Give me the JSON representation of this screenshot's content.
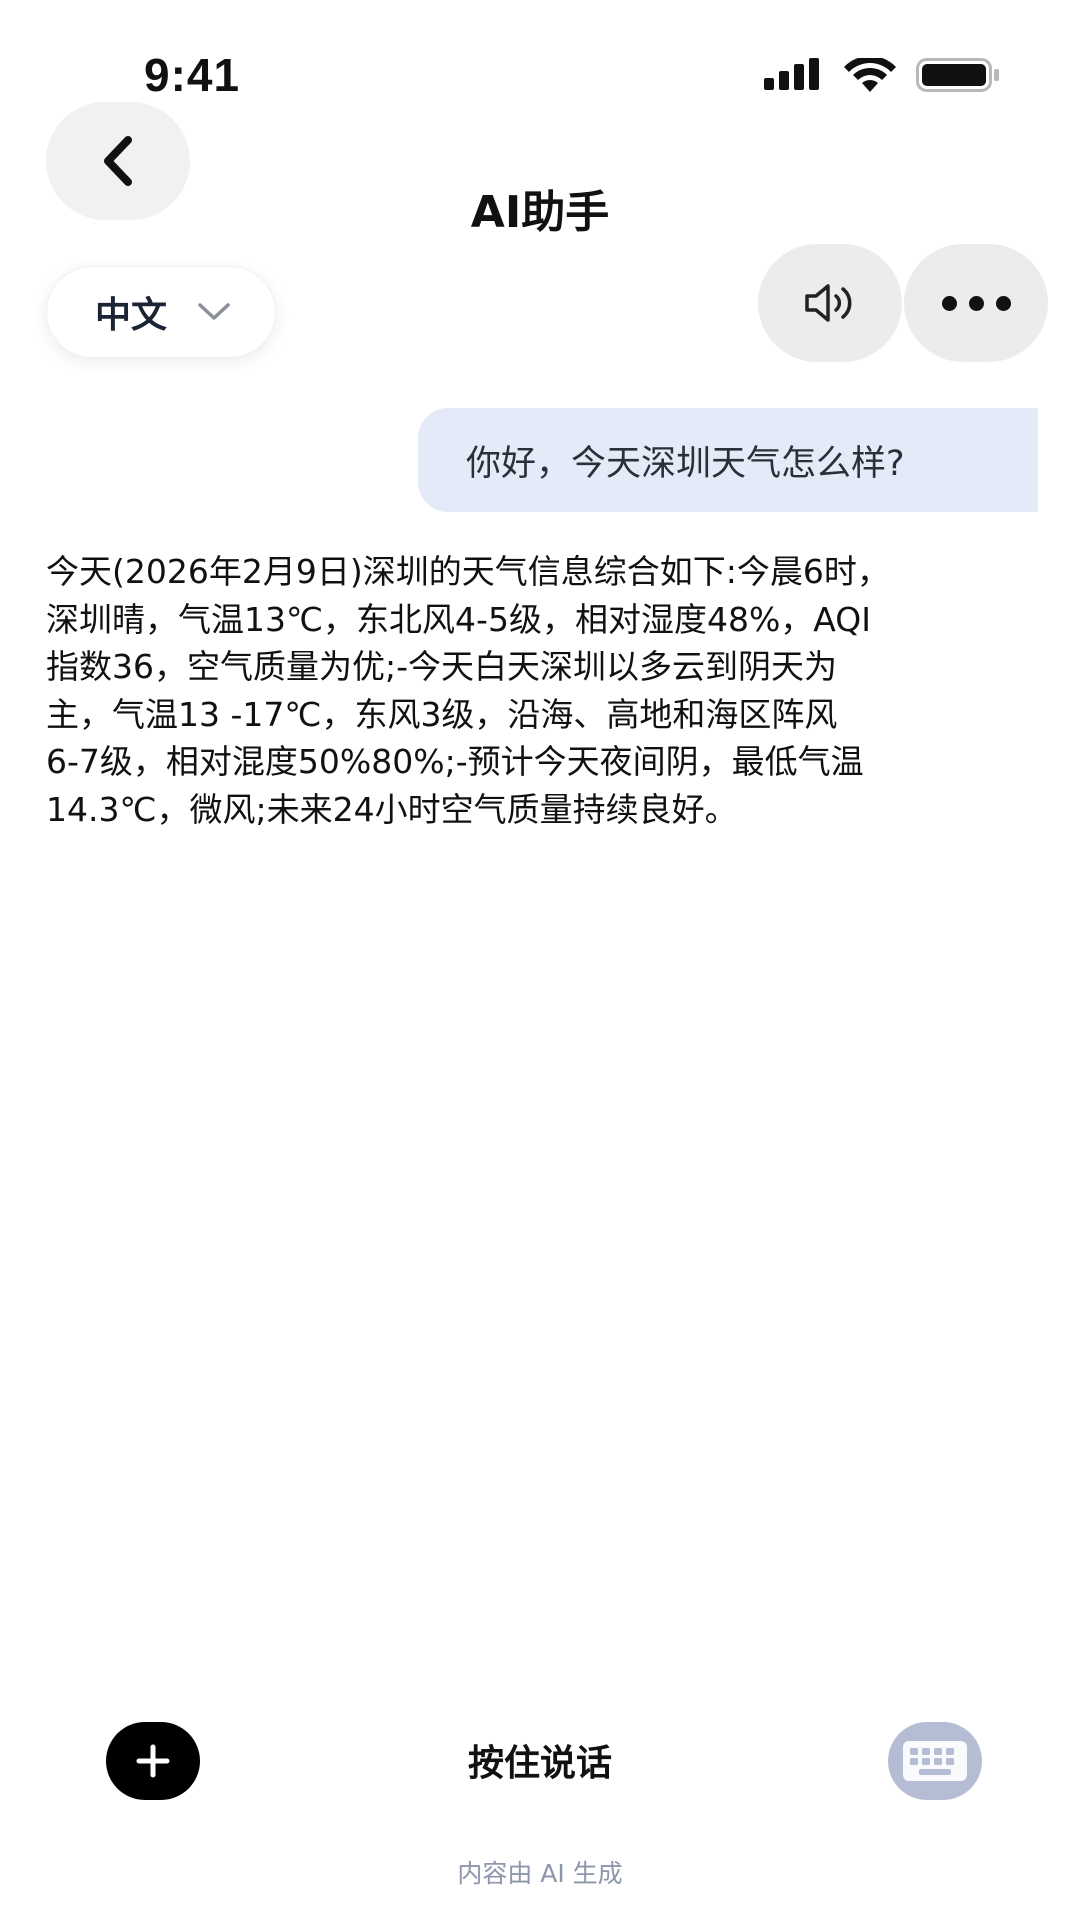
{
  "status_bar": {
    "time": "9:41"
  },
  "header": {
    "title": "AI助手",
    "back_icon": "chevron-left-icon"
  },
  "language_selector": {
    "selected": "中文",
    "icon": "chevron-down-icon"
  },
  "toolbar": {
    "speaker_icon": "speaker-icon",
    "more_icon": "more-dots-icon"
  },
  "chat": {
    "user_message": "你好，今天深圳天气怎么样?",
    "ai_reply": "今天(2026年2月9日)深圳的天气信息综合如下:今晨6时，\n深圳晴，气温13℃，东北风4-5级，相对湿度48%，AQI\n指数36，空气质量为优;-今天白天深圳以多云到阴天为\n主，气温13 -17℃，东风3级，沿海、高地和海区阵风\n6-7级，相对混度50%80%;-预计今天夜间阴，最低气温\n14.3℃，微风;未来24小时空气质量持续良好。"
  },
  "bottom_bar": {
    "hold_to_talk": "按住说话",
    "plus_icon": "plus-icon",
    "keyboard_icon": "keyboard-icon",
    "disclaimer": "内容由 AI 生成"
  },
  "colors": {
    "user_bubble": "#e5eaf8",
    "round_button": "#ececef",
    "keyboard_button": "#b4bdd3",
    "disclaimer_text": "#8d96ab"
  }
}
